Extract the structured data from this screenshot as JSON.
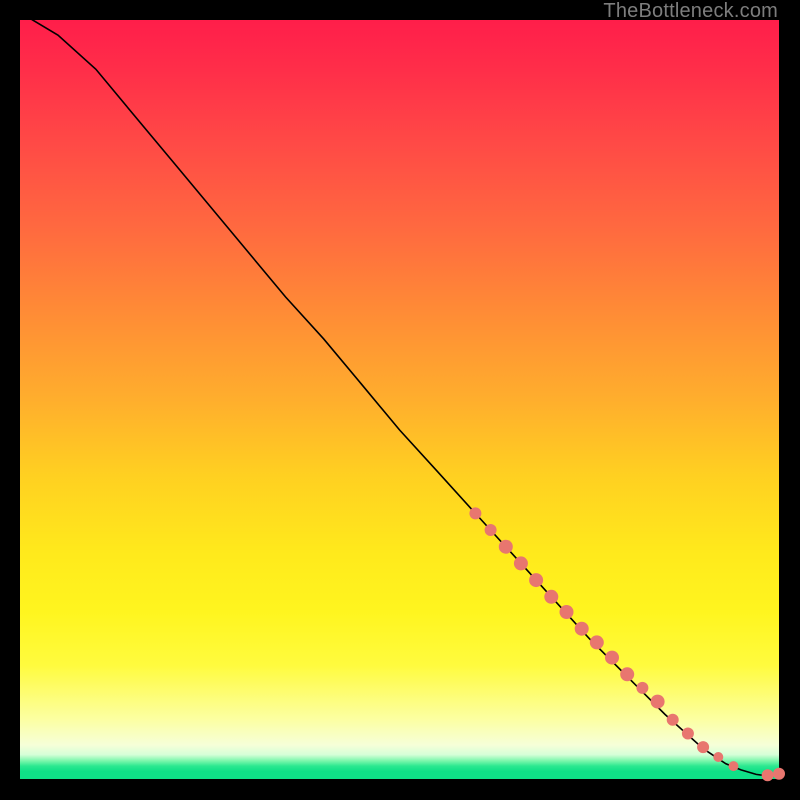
{
  "watermark": "TheBottleneck.com",
  "chart_data": {
    "type": "line",
    "title": "",
    "xlabel": "",
    "ylabel": "",
    "xlim": [
      0,
      100
    ],
    "ylim": [
      0,
      100
    ],
    "x": [
      0,
      5,
      10,
      15,
      20,
      25,
      30,
      35,
      40,
      45,
      50,
      55,
      60,
      65,
      70,
      75,
      80,
      85,
      90,
      93,
      95,
      97,
      98.5,
      100
    ],
    "values": [
      101,
      98,
      93.5,
      87.5,
      81.5,
      75.5,
      69.5,
      63.5,
      58,
      52,
      46,
      40.5,
      35,
      29.5,
      24,
      18.5,
      13.5,
      8.5,
      4,
      2,
      1.2,
      0.6,
      0.4,
      0.7
    ],
    "points_overlay": {
      "comment": "scatter dots along the lower-right segment of the curve",
      "x": [
        60,
        62,
        64,
        66,
        68,
        70,
        72,
        74,
        76,
        78,
        80,
        82,
        84,
        86,
        88,
        90,
        92,
        94,
        98.5,
        100
      ],
      "y": [
        35,
        32.8,
        30.6,
        28.4,
        26.2,
        24,
        22,
        19.8,
        18,
        16,
        13.8,
        12,
        10.2,
        7.8,
        6,
        4.2,
        2.9,
        1.7,
        0.5,
        0.7
      ],
      "r": [
        6,
        6,
        7,
        7,
        7,
        7,
        7,
        7,
        7,
        7,
        7,
        6,
        7,
        6,
        6,
        6,
        5,
        5,
        6,
        6
      ]
    },
    "gradient_stops": [
      {
        "pos": 0,
        "color": "#ff1e4a"
      },
      {
        "pos": 0.5,
        "color": "#ffae2d"
      },
      {
        "pos": 0.78,
        "color": "#fff51f"
      },
      {
        "pos": 0.96,
        "color": "#d6ffd8"
      },
      {
        "pos": 1.0,
        "color": "#0fe087"
      }
    ]
  }
}
